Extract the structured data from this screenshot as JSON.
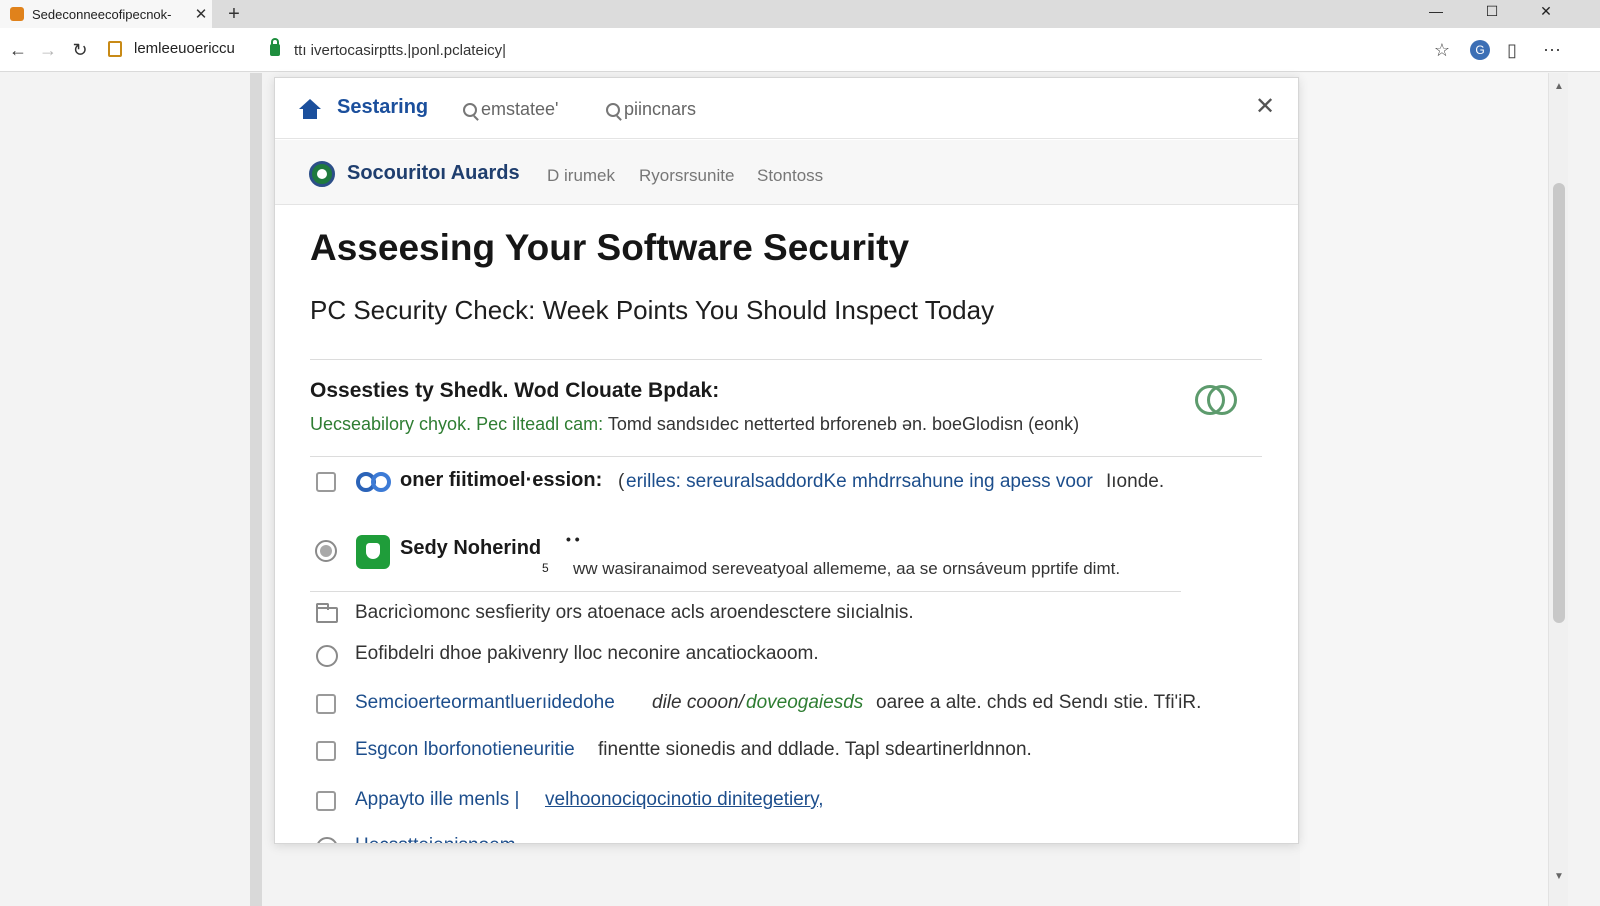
{
  "browser": {
    "tab_title": "Sedeconneecofipecnok-",
    "tab_close": "✕",
    "new_tab": "+",
    "site_label": "lemleeuoericcu",
    "url": "ttı ivertocasirptts.|ponl.pclateicy|",
    "window_controls": {
      "minimize": "—",
      "maximize": "☐",
      "close": "✕"
    }
  },
  "panel": {
    "top_nav": {
      "brand": "Sestaring",
      "search_1": "emstatee'",
      "search_2": "piincnars",
      "close": "✕"
    },
    "sub_nav": {
      "brand": "Socouritoı Auards",
      "links": [
        "D irumek",
        "Ryorsrsunite",
        "Stontoss"
      ]
    },
    "page_title": "Asseesing Your Software Security",
    "page_subtitle": "PC Security Check: Week Points You Should Inspect Today",
    "section": {
      "title": "Ossesties ty Shedk. Wod Clouate Bpdak:",
      "desc_green": "Uecseabilory chyok. Pec ilteadl cam:",
      "desc_rest": "Tomd sandsıdec netterted brforeneb ən. boeGlodisn (eonk)"
    },
    "items": [
      {
        "label": "oner fiitimoel·ession:",
        "paren": "(",
        "detail_blue": "erilles: sereuralsaddordKe mhdrrsahune ing apess voor",
        "detail_rest": "Iıonde."
      },
      {
        "label": "Sedy Noherind",
        "dots": "• •",
        "footnote": "5",
        "detail": "ww wasiranaimod sereveatyoal allememe, aa se ornsáveum pprtife dimt."
      },
      {
        "text": "Bacricìomonc sesfierity ors atoenace acls aroendesctere siıcialnis."
      },
      {
        "text": "Eofibdelri dhoe pakivenry lloc neconire ancatiockaoom."
      },
      {
        "blue": "Semcioerteormantluerıidedohe",
        "italic": "dile cooon/",
        "green": "doveogaiesds",
        "rest": "oaree  a alte. chds ed Sendı stie. Tfi'iR."
      },
      {
        "blue": "Esgcon lborfonotieneuritie",
        "rest": "finentte sionedis and ddlade. Tapl sdeartinerldnnon."
      },
      {
        "blue": "Appayto ille menls |",
        "link": "velhoonociqocinotio dinitegetiery,"
      },
      {
        "text": "Hecsstteienisnoem"
      }
    ]
  },
  "colors": {
    "accent_blue": "#1b4f9c",
    "accent_green": "#2e7d32",
    "shield_green": "#1f9d3a",
    "lock_green": "#1e8e3e"
  },
  "icons": [
    "home-icon",
    "search-icon",
    "close-icon",
    "shield-icon",
    "loop-icon",
    "folder-icon",
    "lock-icon",
    "star-icon",
    "menu-icon"
  ]
}
